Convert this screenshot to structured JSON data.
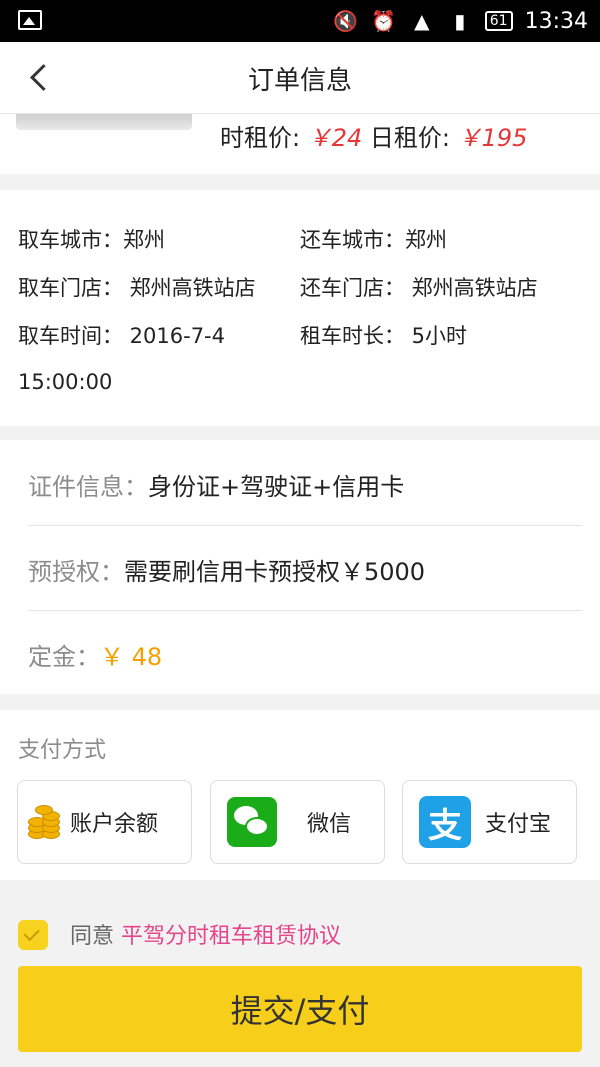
{
  "status_bar": {
    "battery": "61",
    "time": "13:34"
  },
  "header": {
    "title": "订单信息"
  },
  "price": {
    "hour_label": "时租价: ",
    "hour_value": "￥24",
    "day_label": " 日租价: ",
    "day_value": "￥195"
  },
  "rental_info": {
    "pickup_city": "取车城市：郑州",
    "return_city": "还车城市：郑州",
    "pickup_store": "取车门店： 郑州高铁站店",
    "return_store": "还车门店： 郑州高铁站店",
    "pickup_time": "取车时间： 2016-7-4",
    "pickup_time_cont": "15:00:00",
    "duration": "租车时长： 5小时"
  },
  "requirements": {
    "docs_label": "证件信息：",
    "docs_value": "身份证+驾驶证+信用卡",
    "preauth_label": "预授权：",
    "preauth_value": "需要刷信用卡预授权￥5000",
    "deposit_label": "定金：",
    "deposit_value": " ￥ 48"
  },
  "payment": {
    "title": "支付方式",
    "options": [
      {
        "label": "账户余额",
        "icon": "coins-icon"
      },
      {
        "label": "微信",
        "icon": "wechat-icon"
      },
      {
        "label": "支付宝",
        "icon": "alipay-icon"
      }
    ]
  },
  "agreement": {
    "prefix": "同意 ",
    "link": "平驾分时租车租赁协议"
  },
  "submit_label": "提交/支付",
  "colors": {
    "accent_yellow": "#f7cf1b",
    "price_red": "#e43838",
    "deposit_orange": "#f5a000",
    "link_pink": "#e5458a"
  }
}
